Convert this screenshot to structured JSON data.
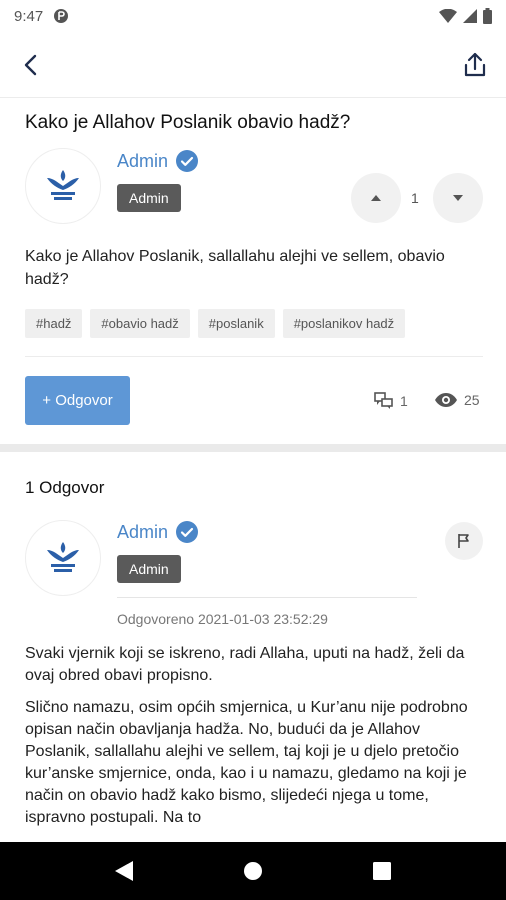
{
  "status_bar": {
    "time": "9:47"
  },
  "question": {
    "title": "Kako je Allahov Poslanik obavio hadž?",
    "author": "Admin",
    "role": "Admin",
    "votes": "1",
    "body": "Kako je Allahov Poslanik, sallallahu alejhi ve sellem, obavio hadž?",
    "tags": [
      "#hadž",
      "#obavio hadž",
      "#poslanik",
      "#poslanikov hadž"
    ],
    "answer_button": "+ Odgovor",
    "answers_count": "1",
    "views": "25"
  },
  "answers": {
    "heading": "1 Odgovor",
    "items": [
      {
        "author": "Admin",
        "role": "Admin",
        "answered_at": "Odgovoreno 2021-01-03 23:52:29",
        "paragraphs": [
          "Svaki vjernik koji se iskreno, radi Allaha, uputi na hadž, želi da ovaj obred obavi propisno.",
          "Slično namazu, osim općih smjernica, u Kur’anu nije podrobno opisan način obavljanja hadža. No, budući da je Allahov Poslanik, sallallahu alejhi ve sellem, taj koji je u djelo pretočio kur’anske smjernice, onda, kao i u namazu, gledamo na koji je način on obavio hadž kako bismo, slijedeći njega u tome, ispravno postupali. Na to"
        ]
      }
    ]
  },
  "colors": {
    "accent": "#5e97d6",
    "link": "#4a86c8",
    "badge": "#5a5a5a"
  },
  "icons": [
    "back-arrow-icon",
    "share-icon",
    "verified-icon",
    "chevron-up-icon",
    "chevron-down-icon",
    "answers-icon",
    "eye-icon",
    "flag-icon",
    "logo-icon",
    "nav-back-icon",
    "nav-home-icon",
    "nav-recents-icon"
  ]
}
